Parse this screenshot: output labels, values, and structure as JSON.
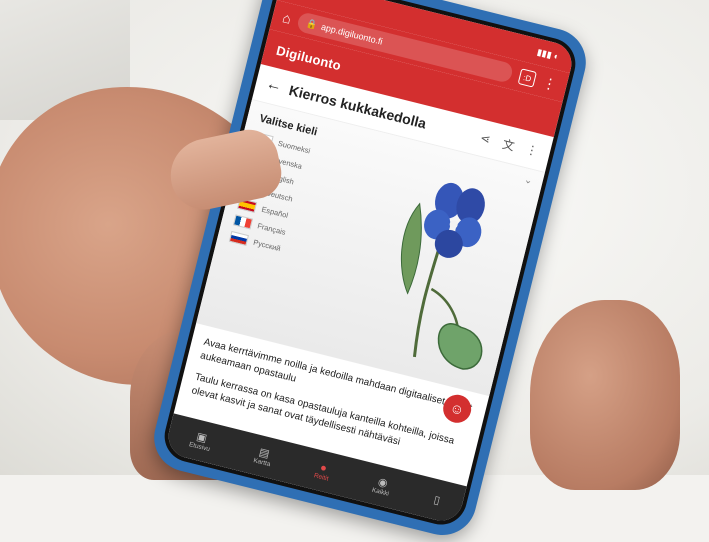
{
  "browser": {
    "url_text": "app.digiluonto.fi",
    "tab_count": ":D"
  },
  "app": {
    "name": "Digiluonto"
  },
  "page": {
    "title": "Kierros kukkakedolla"
  },
  "languages": {
    "heading": "Valitse kieli",
    "items": [
      {
        "label": "Suomeksi",
        "flag": "fi"
      },
      {
        "label": "Svenska",
        "flag": "se"
      },
      {
        "label": "English",
        "flag": "gb"
      },
      {
        "label": "Deutsch",
        "flag": "de"
      },
      {
        "label": "Español",
        "flag": "es"
      },
      {
        "label": "Français",
        "flag": "fr"
      },
      {
        "label": "Русский",
        "flag": "ru"
      }
    ]
  },
  "body": {
    "paragraph1": "Avaa kerrtävimme noilla ja kedoilla mahdaan digitaaliset tuotot aukeamaan opastaulu",
    "paragraph2": "Taulu kerrassa on kasa opastauluja kanteilla kohteilla, joissa olevat kasvit ja sanat ovat täydellisesti nähtäväsi"
  },
  "colors": {
    "accent": "#d32f2f",
    "case": "#2f6fb4",
    "nav_active": "#e24a4a"
  },
  "nav": [
    {
      "label": "Etusivu",
      "icon": "home-icon"
    },
    {
      "label": "Kartta",
      "icon": "map-icon"
    },
    {
      "label": "Reitit",
      "icon": "route-icon"
    },
    {
      "label": "Kaikki",
      "icon": "compass-icon"
    },
    {
      "label": "",
      "icon": "bookmark-icon"
    }
  ]
}
